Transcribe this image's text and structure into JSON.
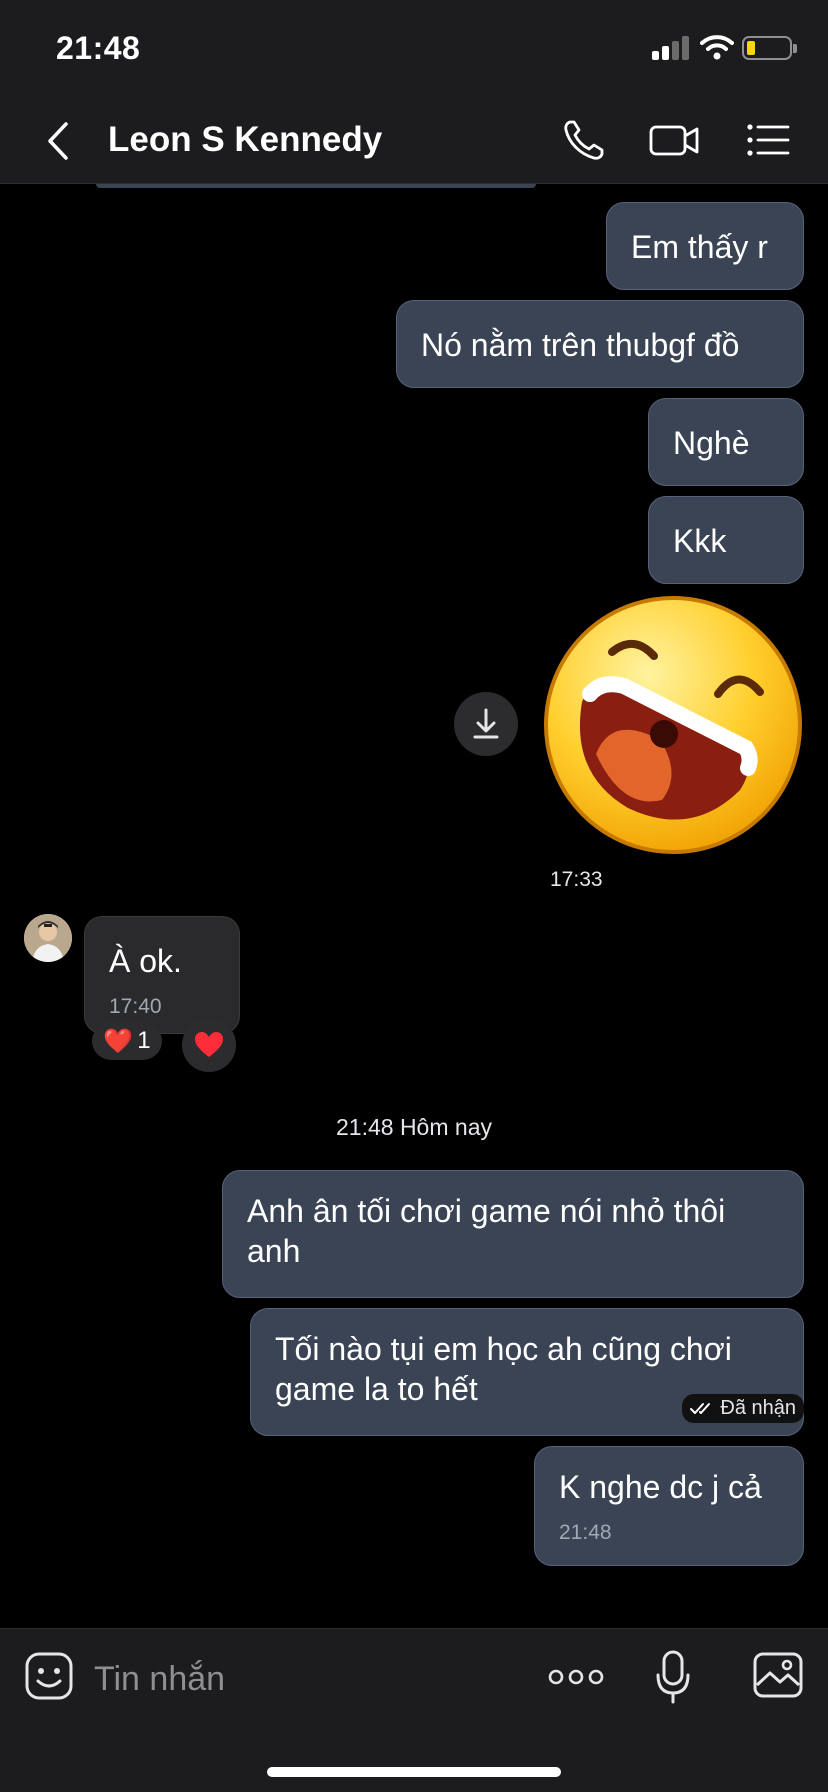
{
  "status_bar": {
    "time": "21:48",
    "battery_color": "#ffd60a"
  },
  "nav": {
    "title": "Leon S Kennedy",
    "icons": [
      "chevron-left-icon",
      "phone-icon",
      "video-camera-icon",
      "list-icon"
    ]
  },
  "messages": [
    {
      "side": "outgoing",
      "text": "Em thấy r"
    },
    {
      "side": "outgoing",
      "text": "Nó nằm trên thubgf đồ"
    },
    {
      "side": "outgoing",
      "text": "Nghè"
    },
    {
      "side": "outgoing",
      "text": "Kkk"
    },
    {
      "side": "outgoing",
      "type": "sticker",
      "sticker": "laughing-face-sticker",
      "time": "17:33"
    },
    {
      "side": "incoming",
      "text": "À ok.",
      "time": "17:40",
      "reaction": {
        "emoji": "❤️",
        "count": "1"
      }
    },
    {
      "side": "outgoing",
      "text": "Anh ân tối chơi game nói nhỏ thôi anh"
    },
    {
      "side": "outgoing",
      "text": "Tối nào tụi em học ah cũng chơi game la to hết"
    },
    {
      "side": "outgoing",
      "text": "K nghe dc j cả",
      "time": "21:48"
    }
  ],
  "day_divider": "21:48 Hôm nay",
  "receipt": "Đã nhận",
  "composer": {
    "placeholder": "Tin nhắn",
    "icons": [
      "sticker-icon",
      "more-icon",
      "microphone-icon",
      "image-icon"
    ]
  },
  "colors": {
    "bubble": "#3a4454",
    "background": "#000000",
    "bar": "#1c1c1e"
  }
}
